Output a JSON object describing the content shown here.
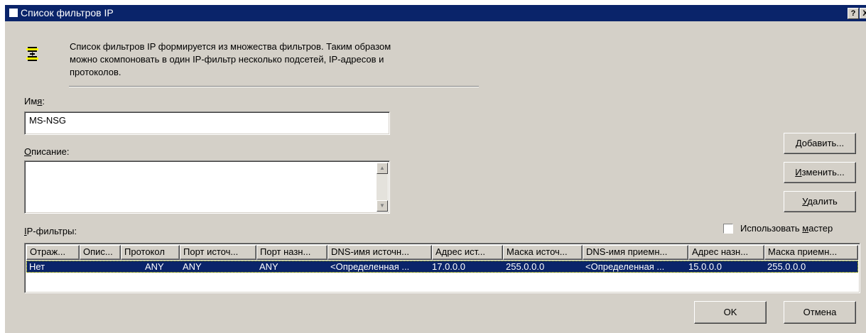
{
  "window": {
    "title": "Список фильтров IP",
    "help_glyph": "?",
    "close_glyph": "X"
  },
  "info": {
    "icon": "filter-list-icon",
    "line1": "Список фильтров IP формируется из множества фильтров. Таким образом",
    "line2": "можно скомпоновать в один IP-фильтр несколько подсетей, IP-адресов и",
    "line3": "протоколов."
  },
  "name": {
    "label_pre": "Им",
    "label_accel": "я",
    "label_post": ":",
    "value": "MS-NSG"
  },
  "description": {
    "label_accel": "О",
    "label_post": "писание:",
    "value": ""
  },
  "buttons": {
    "add_accel": "Д",
    "add_post": "обавить...",
    "edit_accel": "И",
    "edit_post": "зменить...",
    "delete_accel": "У",
    "delete_post": "далить",
    "ok": "OK",
    "cancel": "Отмена"
  },
  "wizard": {
    "label_pre": "Использовать ",
    "label_accel": "м",
    "label_post": "астер",
    "checked": false
  },
  "filters": {
    "label_accel": "I",
    "label_post": "P-фильтры:",
    "columns": [
      "Отраж...",
      "Опис...",
      "Протокол",
      "Порт источ...",
      "Порт назн...",
      "DNS-имя источн...",
      "Адрес ист...",
      "Маска источ...",
      "DNS-имя приемн...",
      "Адрес назн...",
      "Маска приемн..."
    ],
    "rows": [
      [
        "Нет",
        "",
        "ANY",
        "ANY",
        "ANY",
        "<Определенная ...",
        "17.0.0.0",
        "255.0.0.0",
        "<Определенная ...",
        "15.0.0.0",
        "255.0.0.0"
      ]
    ]
  },
  "colors": {
    "title_bar": "#0a246a",
    "face": "#d4d0c8",
    "selection": "#0a246a"
  }
}
